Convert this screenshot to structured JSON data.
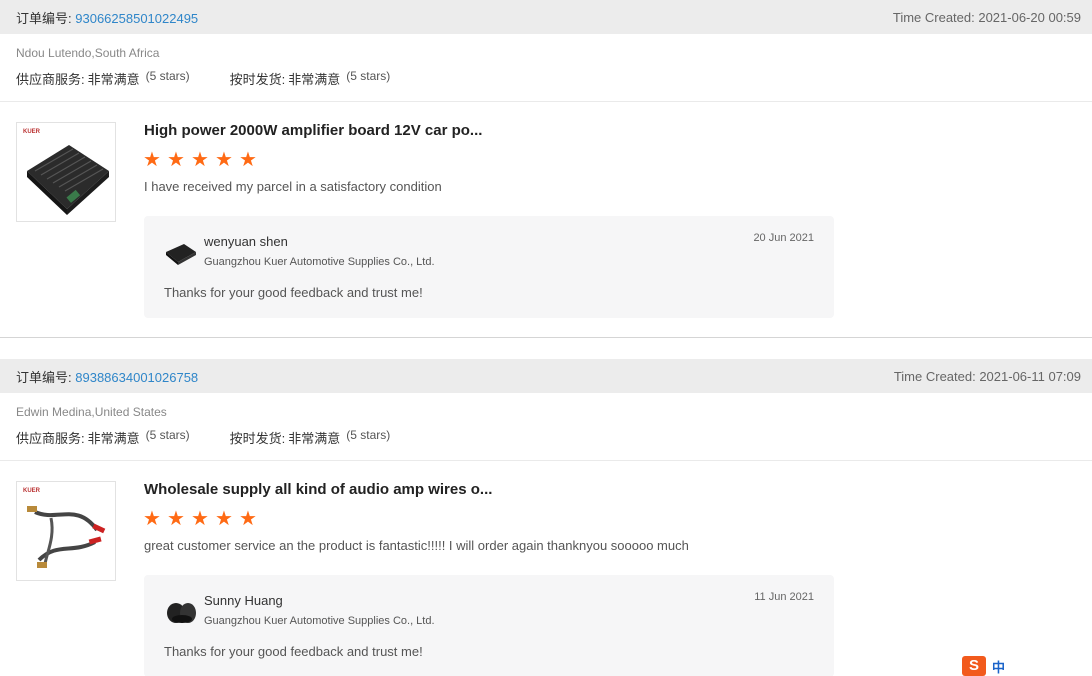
{
  "reviews": [
    {
      "order_label": "订单编号:",
      "order_number": "93066258501022495",
      "time_created": "Time Created: 2021-06-20 00:59",
      "buyer": "Ndou Lutendo,South Africa",
      "ratings": [
        {
          "key": "供应商服务:",
          "value": "非常满意",
          "stars": "(5 stars)"
        },
        {
          "key": "按时发货:",
          "value": "非常满意",
          "stars": "(5 stars)"
        }
      ],
      "product_title": "High power 2000W amplifier board 12V car po...",
      "star_rating": 5,
      "comment": "I have received my parcel in a satisfactory condition",
      "reply": {
        "name": "wenyuan shen",
        "company": "Guangzhou Kuer Automotive Supplies Co., Ltd.",
        "date": "20 Jun 2021",
        "text": "Thanks for your good feedback and trust me!"
      }
    },
    {
      "order_label": "订单编号:",
      "order_number": "89388634001026758",
      "time_created": "Time Created: 2021-06-11 07:09",
      "buyer": "Edwin Medina,United States",
      "ratings": [
        {
          "key": "供应商服务:",
          "value": "非常满意",
          "stars": "(5 stars)"
        },
        {
          "key": "按时发货:",
          "value": "非常满意",
          "stars": "(5 stars)"
        }
      ],
      "product_title": "Wholesale supply all kind of audio amp wires o...",
      "star_rating": 5,
      "comment": "great customer service an the product is fantastic!!!!! I will order again thanknyou sooooo much",
      "reply": {
        "name": "Sunny Huang",
        "company": "Guangzhou Kuer Automotive Supplies Co., Ltd.",
        "date": "11 Jun 2021",
        "text": "Thanks for your good feedback and trust me!"
      }
    }
  ],
  "ime_bar": {
    "logo": "S",
    "glyph": "中"
  },
  "colors": {
    "accent_link": "#2f86c9",
    "star": "#ff6a14",
    "header_bg": "#ececec",
    "reply_bg": "#f6f6f7"
  }
}
